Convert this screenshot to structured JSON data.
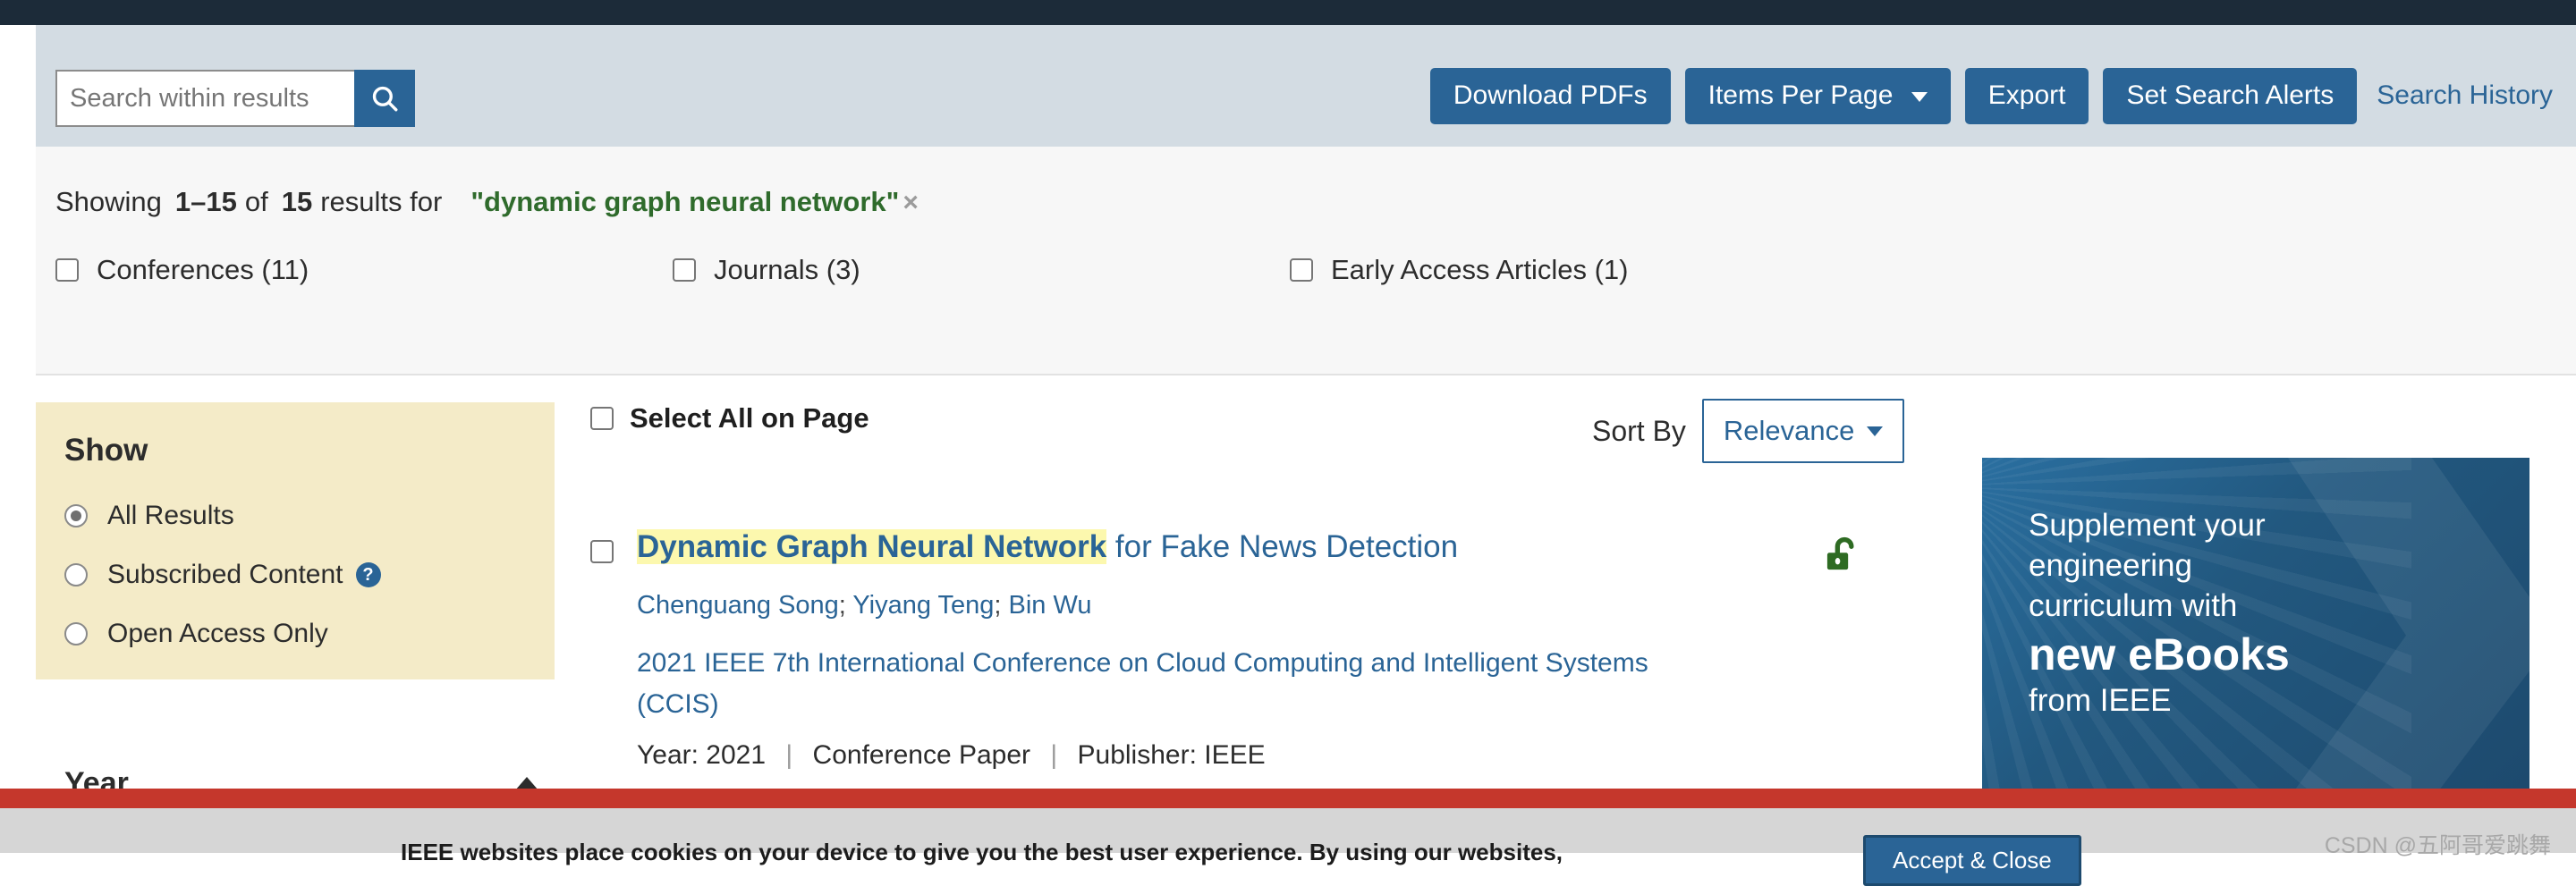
{
  "colors": {
    "navy_top": "#1c2b39",
    "band_blue": "#d3dce3",
    "accent_blue": "#2a6496",
    "facet_panel": "#f4ebc8",
    "highlight_yellow": "#fcf8ae",
    "query_green": "#2f6b2c",
    "open_access_green": "#2e6b23",
    "red_bar": "#c5372c",
    "ad_orange": "#e07b39"
  },
  "search": {
    "placeholder": "Search within results",
    "value": "",
    "search_icon": "search-icon"
  },
  "toolbar": {
    "download_pdfs": "Download PDFs",
    "items_per_page": "Items Per Page",
    "export": "Export",
    "set_search_alerts": "Set Search Alerts",
    "search_history": "Search History"
  },
  "summary": {
    "showing_label": "Showing",
    "range": "1–15",
    "of_label": "of",
    "total": "15",
    "results_for_label": "results for",
    "query": "\"dynamic graph neural network\"",
    "remove_icon": "×"
  },
  "facets": [
    {
      "label": "Conferences (11)",
      "checked": false
    },
    {
      "label": "Journals (3)",
      "checked": false
    },
    {
      "label": "Early Access Articles (1)",
      "checked": false
    }
  ],
  "sidebar": {
    "show_title": "Show",
    "options": [
      {
        "label": "All Results",
        "selected": true,
        "help": false
      },
      {
        "label": "Subscribed Content",
        "selected": false,
        "help": true,
        "help_glyph": "?"
      },
      {
        "label": "Open Access Only",
        "selected": false,
        "help": false
      }
    ],
    "year_section": {
      "label": "Year",
      "expanded": true,
      "chevron": "chevron-up-icon"
    }
  },
  "results_header": {
    "select_all": "Select All on Page",
    "sort_by_label": "Sort By",
    "sort_value": "Relevance"
  },
  "result": {
    "title_highlight": "Dynamic Graph Neural Network",
    "title_rest": " for Fake News Detection",
    "authors": [
      "Chenguang Song",
      "Yiyang Teng",
      "Bin Wu"
    ],
    "author_separator": "; ",
    "publication": "2021 IEEE 7th International Conference on Cloud Computing and Intelligent Systems (CCIS)",
    "year_label": "Year:",
    "year_value": "2021",
    "type": "Conference Paper",
    "publisher_label": "Publisher:",
    "publisher_value": "IEEE",
    "open_access_icon": "open-lock-icon",
    "checked": false
  },
  "advertisement": {
    "line1": "Supplement your",
    "line2": "engineering",
    "line3": "curriculum with",
    "emphasis": "new eBooks",
    "line4": "from IEEE"
  },
  "cookie_banner": {
    "text": "IEEE websites place cookies on your device to give you the best user experience. By using our websites,",
    "accept_label": "Accept & Close"
  },
  "watermark": "CSDN @五阿哥爱跳舞"
}
